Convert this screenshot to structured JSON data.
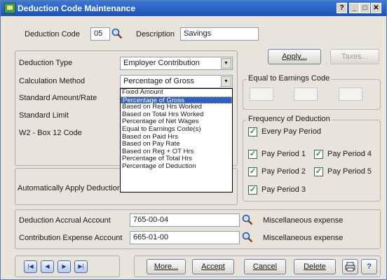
{
  "window": {
    "title": "Deduction Code Maintenance",
    "help_label": "?"
  },
  "header": {
    "deduction_code_label": "Deduction Code",
    "deduction_code_value": "05",
    "description_label": "Description",
    "description_value": "Savings"
  },
  "form": {
    "deduction_type_label": "Deduction Type",
    "deduction_type_value": "Employer Contribution",
    "calculation_method_label": "Calculation Method",
    "calculation_method_value": "Percentage of Gross",
    "standard_amount_label": "Standard Amount/Rate",
    "standard_limit_label": "Standard Limit",
    "w2_box_label": "W2 - Box 12 Code",
    "auto_apply_label": "Automatically Apply Deduction"
  },
  "calculation_options": [
    "Fixed Amount",
    "Percentage of Gross",
    "Based on Reg Hrs Worked",
    "Based on Total Hrs Worked",
    "Percentage of Net Wages",
    "Equal to Earnings Code(s)",
    "Based on Paid Hrs",
    "Based on Pay Rate",
    "Based on Reg + OT Hrs",
    "Percentage of Total Hrs",
    "Percentage of Deduction"
  ],
  "selected_option_index": 1,
  "right_panel": {
    "apply_label": "Apply...",
    "taxes_label": "Taxes...",
    "equal_to_earnings_title": "Equal to Earnings Code",
    "frequency_title": "Frequency of Deduction",
    "every_pay_period": "Every Pay Period",
    "pay_period_1": "Pay Period 1",
    "pay_period_2": "Pay Period 2",
    "pay_period_3": "Pay Period 3",
    "pay_period_4": "Pay Period 4",
    "pay_period_5": "Pay Period 5"
  },
  "accounts": {
    "accrual_label": "Deduction Accrual Account",
    "accrual_value": "765-00-04",
    "accrual_desc": "Miscellaneous expense",
    "contribution_label": "Contribution Expense Account",
    "contribution_value": "665-01-00",
    "contribution_desc": "Miscellaneous expense"
  },
  "footer": {
    "more_label": "More...",
    "accept_label": "Accept",
    "cancel_label": "Cancel",
    "delete_label": "Delete"
  }
}
